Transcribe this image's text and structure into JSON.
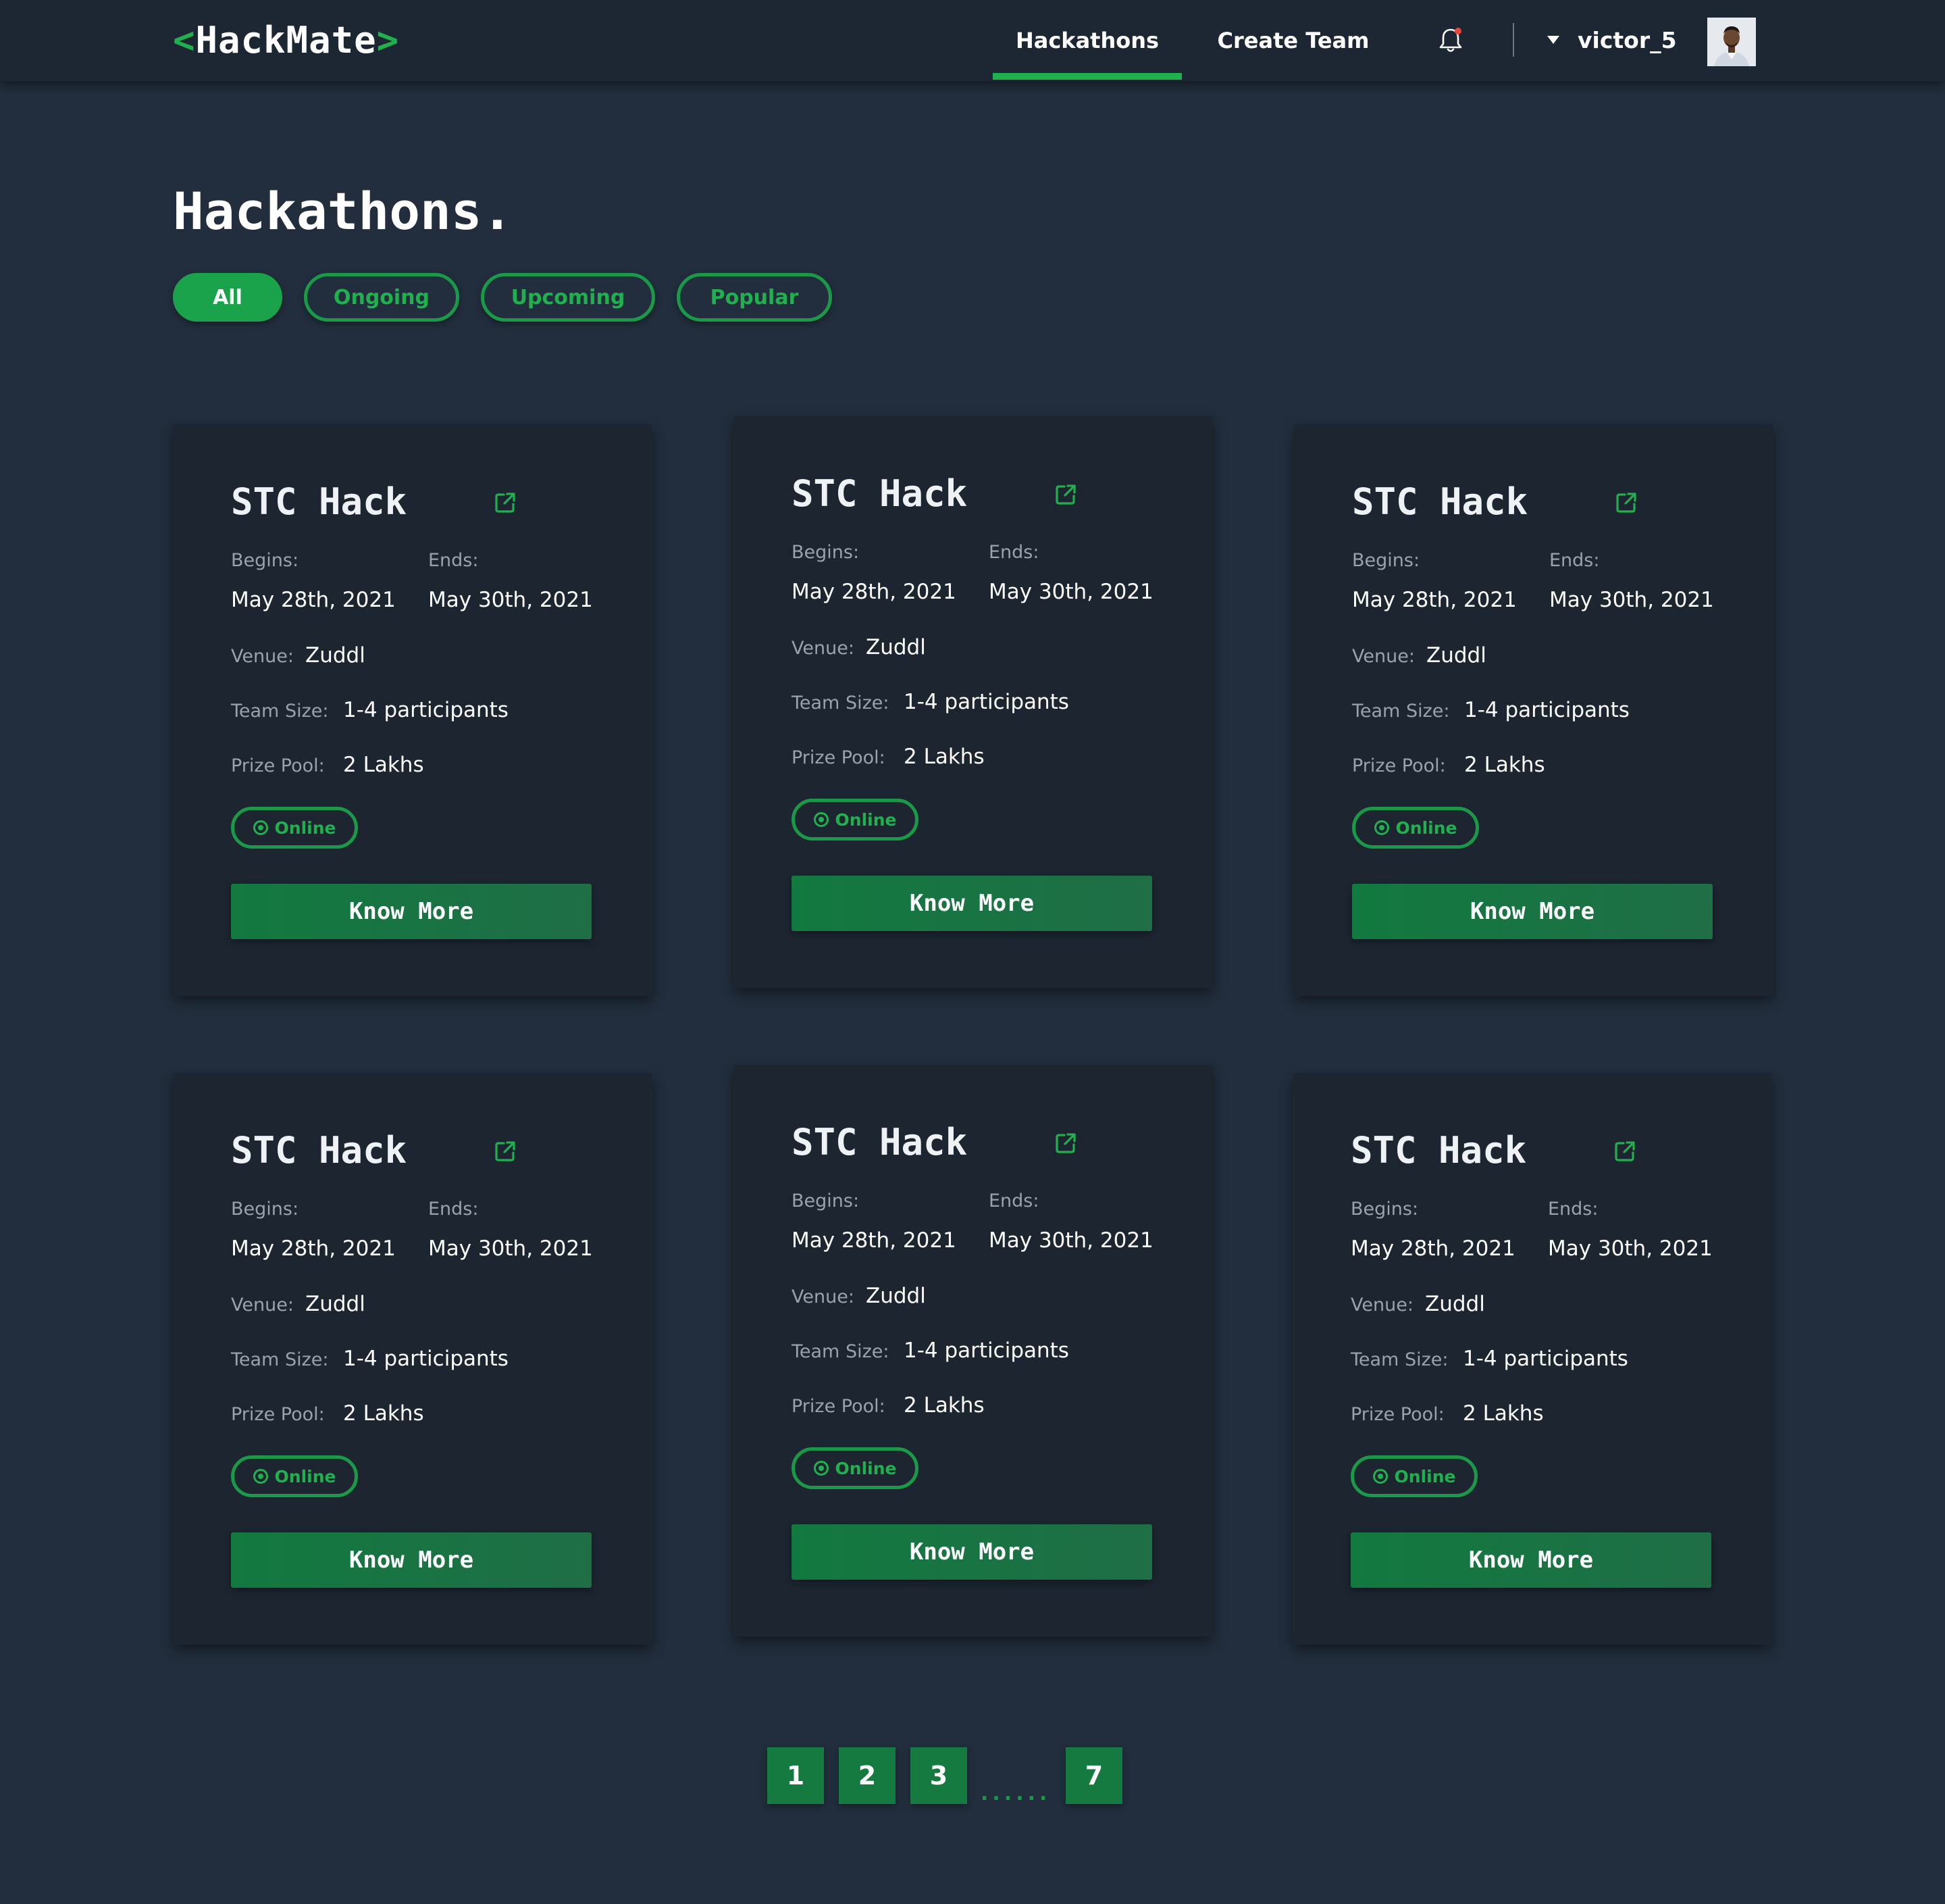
{
  "navbar": {
    "logo_open": "<",
    "logo_text": "HackMate",
    "logo_close": ">",
    "links": [
      {
        "label": "Hackathons",
        "active": true
      },
      {
        "label": "Create Team",
        "active": false
      }
    ],
    "username": "victor_5",
    "notification_icon": "bell-icon",
    "accent_color": "#20b04e"
  },
  "page": {
    "title": "Hackathons."
  },
  "filters": [
    {
      "label": "All",
      "active": true
    },
    {
      "label": "Ongoing",
      "active": false
    },
    {
      "label": "Upcoming",
      "active": false
    },
    {
      "label": "Popular",
      "active": false
    }
  ],
  "labels": {
    "begins": "Begins:",
    "ends": "Ends:",
    "venue": "Venue:",
    "team_size": "Team Size:",
    "prize_pool": "Prize Pool:"
  },
  "hackathons": [
    {
      "title": "STC Hack",
      "begins": "May 28th, 2021",
      "ends": "May 30th, 2021",
      "venue": "Zuddl",
      "team_size": "1-4 participants",
      "prize_pool": "2 Lakhs",
      "mode": "Online",
      "button": "Know More"
    },
    {
      "title": "STC Hack",
      "begins": "May 28th, 2021",
      "ends": "May 30th, 2021",
      "venue": "Zuddl",
      "team_size": "1-4 participants",
      "prize_pool": "2 Lakhs",
      "mode": "Online",
      "button": "Know More"
    },
    {
      "title": "STC Hack",
      "begins": "May 28th, 2021",
      "ends": "May 30th, 2021",
      "venue": "Zuddl",
      "team_size": "1-4 participants",
      "prize_pool": "2 Lakhs",
      "mode": "Online",
      "button": "Know More"
    },
    {
      "title": "STC Hack",
      "begins": "May 28th, 2021",
      "ends": "May 30th, 2021",
      "venue": "Zuddl",
      "team_size": "1-4 participants",
      "prize_pool": "2 Lakhs",
      "mode": "Online",
      "button": "Know More"
    },
    {
      "title": "STC Hack",
      "begins": "May 28th, 2021",
      "ends": "May 30th, 2021",
      "venue": "Zuddl",
      "team_size": "1-4 participants",
      "prize_pool": "2 Lakhs",
      "mode": "Online",
      "button": "Know More"
    },
    {
      "title": "STC Hack",
      "begins": "May 28th, 2021",
      "ends": "May 30th, 2021",
      "venue": "Zuddl",
      "team_size": "1-4 participants",
      "prize_pool": "2 Lakhs",
      "mode": "Online",
      "button": "Know More"
    }
  ],
  "pagination": {
    "pages": [
      "1",
      "2",
      "3",
      "7"
    ],
    "ellipsis": "......"
  }
}
